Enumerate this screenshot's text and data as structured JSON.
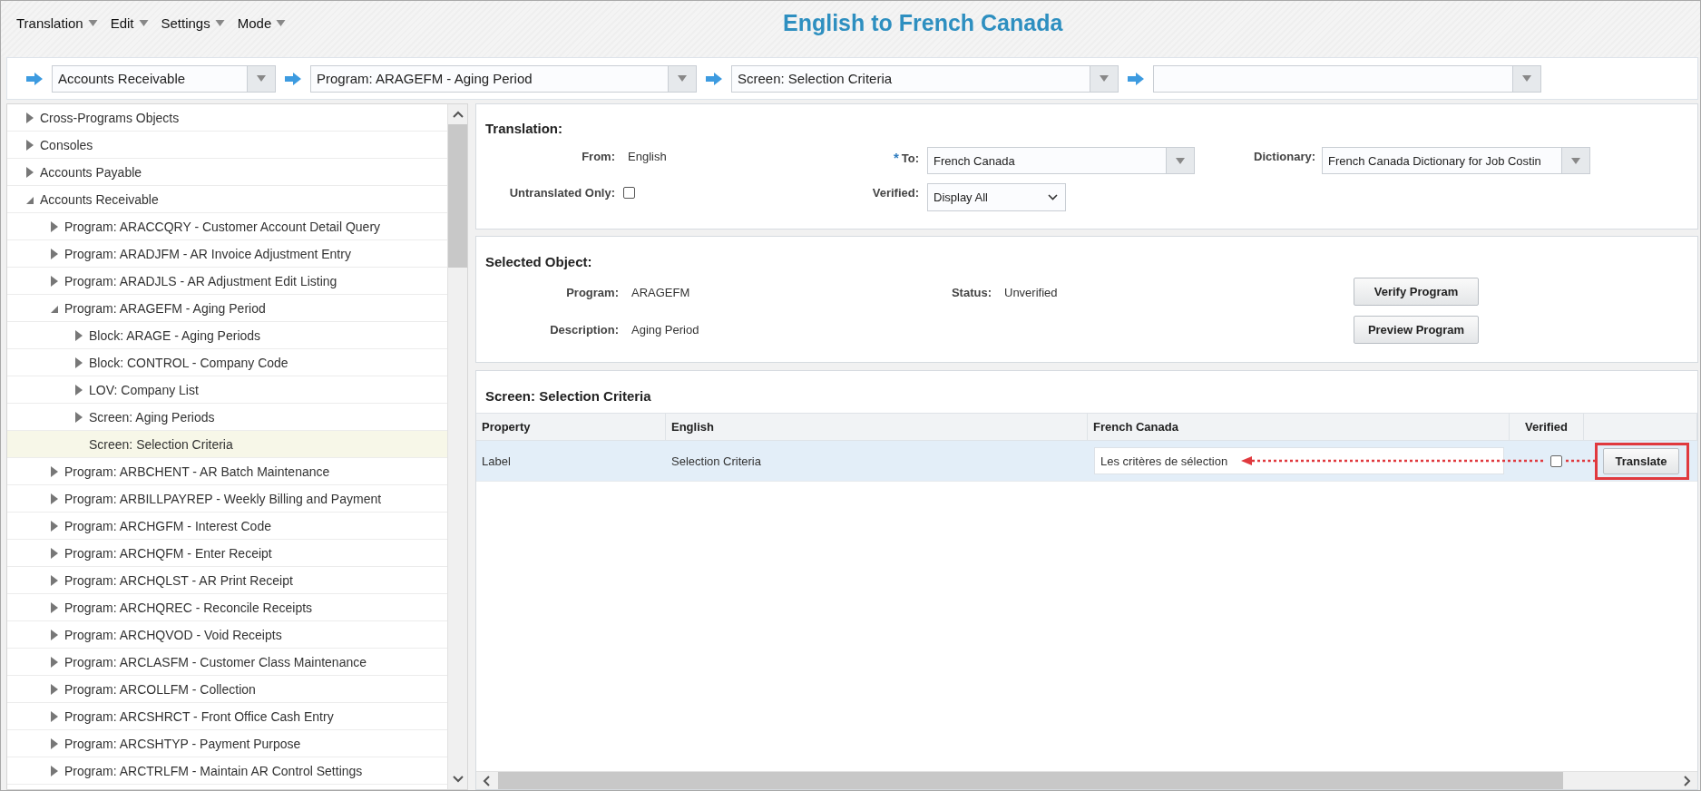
{
  "menu": [
    {
      "label": "Translation"
    },
    {
      "label": "Edit"
    },
    {
      "label": "Settings"
    },
    {
      "label": "Mode"
    }
  ],
  "window": {
    "title": "English to French Canada"
  },
  "breadcrumbs": [
    {
      "value": "Accounts Receivable"
    },
    {
      "value": "Program: ARAGEFM - Aging Period"
    },
    {
      "value": "Screen: Selection Criteria"
    }
  ],
  "tree": {
    "items": [
      {
        "label": "Cross-Programs Objects",
        "kind": "branch",
        "expanded": false,
        "selected": false
      },
      {
        "label": "Consoles",
        "kind": "branch",
        "expanded": false,
        "selected": false
      },
      {
        "label": "Accounts Payable",
        "kind": "branch",
        "expanded": false,
        "selected": false
      },
      {
        "label": "Accounts Receivable",
        "kind": "branch",
        "expanded": true,
        "selected": false,
        "children": [
          {
            "label": "Program: ARACCQRY - Customer Account Detail Query",
            "kind": "branch",
            "expanded": false,
            "selected": false
          },
          {
            "label": "Program: ARADJFM - AR Invoice Adjustment Entry",
            "kind": "branch",
            "expanded": false,
            "selected": false
          },
          {
            "label": "Program: ARADJLS - AR Adjustment Edit Listing",
            "kind": "branch",
            "expanded": false,
            "selected": false
          },
          {
            "label": "Program: ARAGEFM - Aging Period",
            "kind": "branch",
            "expanded": true,
            "selected": false,
            "children": [
              {
                "label": "Block: ARAGE - Aging Periods",
                "kind": "branch",
                "expanded": false,
                "selected": false
              },
              {
                "label": "Block: CONTROL - Company Code",
                "kind": "branch",
                "expanded": false,
                "selected": false
              },
              {
                "label": "LOV: Company List",
                "kind": "branch",
                "expanded": false,
                "selected": false
              },
              {
                "label": "Screen: Aging Periods",
                "kind": "branch",
                "expanded": false,
                "selected": false
              },
              {
                "label": "Screen: Selection Criteria",
                "kind": "leaf",
                "selected": true
              }
            ]
          },
          {
            "label": "Program: ARBCHENT - AR Batch Maintenance",
            "kind": "branch",
            "expanded": false,
            "selected": false
          },
          {
            "label": "Program: ARBILLPAYREP - Weekly Billing and Payment",
            "kind": "branch",
            "expanded": false,
            "selected": false
          },
          {
            "label": "Program: ARCHGFM - Interest Code",
            "kind": "branch",
            "expanded": false,
            "selected": false
          },
          {
            "label": "Program: ARCHQFM - Enter Receipt",
            "kind": "branch",
            "expanded": false,
            "selected": false
          },
          {
            "label": "Program: ARCHQLST - AR Print Receipt",
            "kind": "branch",
            "expanded": false,
            "selected": false
          },
          {
            "label": "Program: ARCHQREC - Reconcile Receipts",
            "kind": "branch",
            "expanded": false,
            "selected": false
          },
          {
            "label": "Program: ARCHQVOD - Void Receipts",
            "kind": "branch",
            "expanded": false,
            "selected": false
          },
          {
            "label": "Program: ARCLASFM - Customer Class Maintenance",
            "kind": "branch",
            "expanded": false,
            "selected": false
          },
          {
            "label": "Program: ARCOLLFM - Collection",
            "kind": "branch",
            "expanded": false,
            "selected": false
          },
          {
            "label": "Program: ARCSHRCT - Front Office Cash Entry",
            "kind": "branch",
            "expanded": false,
            "selected": false
          },
          {
            "label": "Program: ARCSHTYP - Payment Purpose",
            "kind": "branch",
            "expanded": false,
            "selected": false
          },
          {
            "label": "Program: ARCTRLFM - Maintain AR Control Settings",
            "kind": "branch",
            "expanded": false,
            "selected": false
          }
        ]
      }
    ]
  },
  "translation": {
    "title": "Translation:",
    "from": {
      "label": "From:",
      "value": "English"
    },
    "to": {
      "marker": "*",
      "label": "To:",
      "value": "French Canada"
    },
    "dictionary": {
      "label": "Dictionary:",
      "value": "French Canada Dictionary for Job Costin"
    },
    "untranslated_only": {
      "label": "Untranslated Only:",
      "checked": false
    },
    "verified": {
      "label": "Verified:",
      "value": "Display All"
    }
  },
  "selected_object": {
    "title": "Selected Object:",
    "program": {
      "label": "Program:",
      "value": "ARAGEFM"
    },
    "status": {
      "label": "Status:",
      "value": "Unverified"
    },
    "description": {
      "label": "Description:",
      "value": "Aging Period"
    },
    "buttons": [
      "Verify Program",
      "Preview Program"
    ]
  },
  "screen": {
    "title": "Screen: Selection Criteria",
    "table": {
      "columns": [
        "Property",
        "English",
        "French Canada",
        "Verified"
      ],
      "rows": [
        {
          "property": "Label",
          "english": "Selection Criteria",
          "french_canada": "Les critères de sélection",
          "verified": false,
          "action": "Translate",
          "selected": true
        }
      ]
    }
  }
}
